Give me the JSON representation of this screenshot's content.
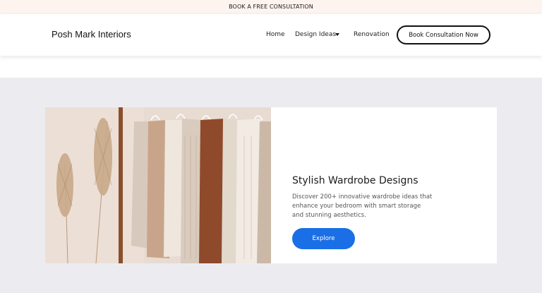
{
  "announcement": {
    "text": "BOOK A FREE CONSULTATION"
  },
  "header": {
    "logo": "Posh Mark Interiors",
    "nav": {
      "home": "Home",
      "design_ideas": "Design Ideas",
      "renovation": "Renovation"
    },
    "cta_label": "Book Consultation Now"
  },
  "feature": {
    "title": "Stylish Wardrobe Designs",
    "description": "Discover 200+ innovative wardrobe ideas that enhance your bedroom with smart storage and stunning aesthetics.",
    "button_label": "Explore"
  },
  "colors": {
    "announcement_bg": "#fdf4ef",
    "section_bg": "#ececf0",
    "accent": "#1a6fe6"
  },
  "icons": {
    "nav_dropdown": "caret-down-icon"
  }
}
